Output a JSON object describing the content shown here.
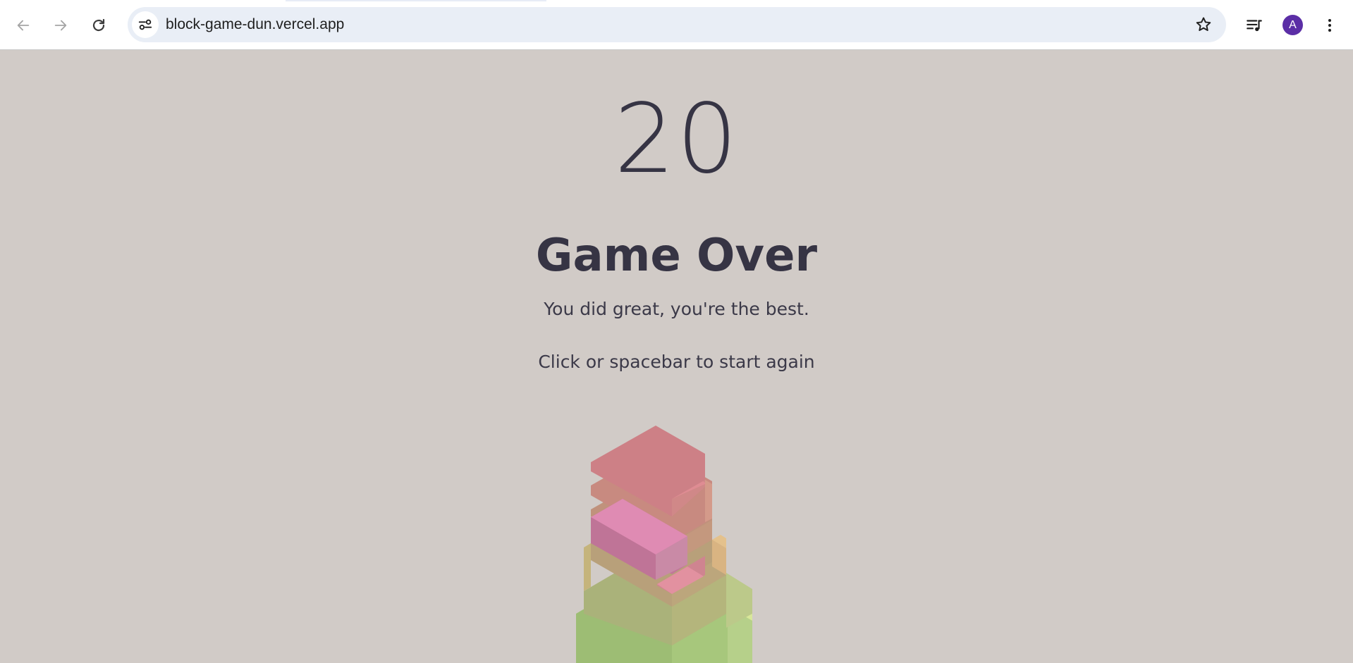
{
  "browser": {
    "url": "block-game-dun.vercel.app",
    "profile_initial": "A",
    "icons": {
      "back": "arrow-left-icon",
      "forward": "arrow-right-icon",
      "reload": "reload-icon",
      "site_info": "tune-icon",
      "bookmark": "star-icon",
      "media": "media-queue-icon",
      "menu": "kebab-menu-icon"
    }
  },
  "game": {
    "score": "20",
    "status_title": "Game Over",
    "message": "You did great, you're the best.",
    "restart_hint": "Click or spacebar to start again"
  },
  "colors": {
    "background": "#d1cbc7",
    "text": "#363444",
    "top_block": "#df8bb3",
    "avatar": "#5b2ea6"
  }
}
